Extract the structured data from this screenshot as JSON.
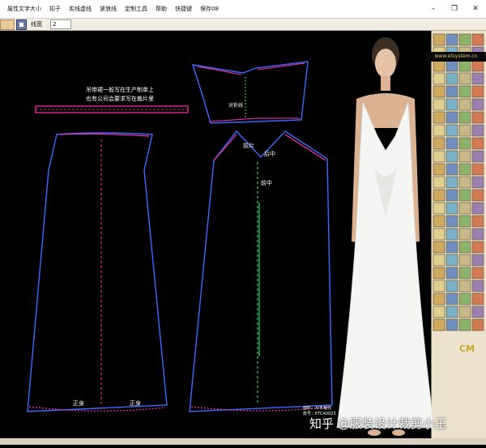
{
  "menubar": {
    "items": [
      "属性文字大小",
      "扣子",
      "实线虚线",
      "波浪线",
      "定制工具",
      "帮助",
      "快捷键",
      "保存08"
    ]
  },
  "window_controls": {
    "minimize": "–",
    "restore": "❐",
    "close": "✕"
  },
  "toolbar": {
    "label": "线宽",
    "value": "2"
  },
  "panel": {
    "logo_text": "www.etsystem.cn",
    "cm_label": "CM"
  },
  "pattern": {
    "note_line1": "吊带裙一般写在生产制单上",
    "note_line2": "也有公司会要求写在裁片里",
    "front_center": "前中",
    "fold": "对折线",
    "back_center": "后中",
    "front_label": "前片",
    "hem_label_left": "正身",
    "hem_label_right": "正身",
    "info_line1": "面料：X/未裁完",
    "info_line2": "款号：ETCA0023"
  },
  "watermark": {
    "text": "知乎 @服装设计裁剪小玉"
  },
  "colors": {
    "canvas": "#000000",
    "panel": "#ece3cf",
    "pink": "#ff2fb5",
    "blue": "#3b6bff",
    "green": "#33ff66",
    "white_text": "#ffffff"
  }
}
